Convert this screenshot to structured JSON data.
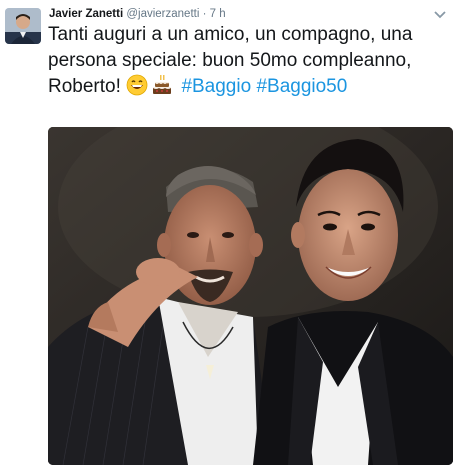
{
  "tweet": {
    "display_name": "Javier Zanetti",
    "handle": "@javierzanetti",
    "separator": "·",
    "time": "7 h",
    "text_main": "Tanti auguri a un amico, un compagno, una persona speciale: buon 50mo compleanno, Roberto!",
    "hashtags": [
      "#Baggio",
      "#Baggio50"
    ],
    "emojis": [
      "grinning-face-emoji",
      "birthday-cake-emoji"
    ]
  },
  "icons": {
    "more": "chevron-down-icon"
  },
  "colors": {
    "link": "#1b95e0",
    "text": "#14171a",
    "meta": "#657786"
  }
}
